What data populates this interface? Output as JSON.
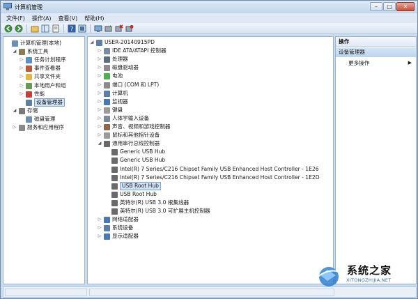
{
  "window": {
    "title": "计算机管理",
    "min_label": "–",
    "max_label": "□",
    "close_label": "✕"
  },
  "menu": [
    "文件(F)",
    "操作(A)",
    "查看(V)",
    "帮助(H)"
  ],
  "left_tree": [
    {
      "label": "计算机管理(本地)",
      "depth": 0,
      "expander": "",
      "icon": "computer-management-icon",
      "color": "#6a8fb8"
    },
    {
      "label": "系统工具",
      "depth": 1,
      "expander": "◢",
      "icon": "system-tools-icon",
      "color": "#8b7d5a"
    },
    {
      "label": "任务计划程序",
      "depth": 2,
      "expander": "▷",
      "icon": "task-scheduler-icon",
      "color": "#5b8fc7"
    },
    {
      "label": "事件查看器",
      "depth": 2,
      "expander": "▷",
      "icon": "event-viewer-icon",
      "color": "#b85a3c"
    },
    {
      "label": "共享文件夹",
      "depth": 2,
      "expander": "▷",
      "icon": "shared-folder-icon",
      "color": "#e0b64a"
    },
    {
      "label": "本地用户和组",
      "depth": 2,
      "expander": "▷",
      "icon": "users-icon",
      "color": "#6a9a5a"
    },
    {
      "label": "性能",
      "depth": 2,
      "expander": "▷",
      "icon": "performance-icon",
      "color": "#c83c3c"
    },
    {
      "label": "设备管理器",
      "depth": 2,
      "expander": "",
      "icon": "device-manager-icon",
      "color": "#5f7f9f",
      "selected": true
    },
    {
      "label": "存储",
      "depth": 1,
      "expander": "◢",
      "icon": "storage-icon",
      "color": "#7a7a7a"
    },
    {
      "label": "磁盘管理",
      "depth": 2,
      "expander": "",
      "icon": "disk-management-icon",
      "color": "#6e8fae"
    },
    {
      "label": "服务和应用程序",
      "depth": 1,
      "expander": "▷",
      "icon": "services-icon",
      "color": "#8a8a8a"
    }
  ],
  "device_tree": [
    {
      "label": "USER-20140915PD",
      "depth": 0,
      "expander": "◢",
      "icon": "computer-icon",
      "color": "#5a7fa8"
    },
    {
      "label": "IDE ATA/ATAPI 控制器",
      "depth": 1,
      "expander": "▷",
      "icon": "ide-controller-icon",
      "color": "#7b8ca0"
    },
    {
      "label": "处理器",
      "depth": 1,
      "expander": "▷",
      "icon": "processor-icon",
      "color": "#5b6e80"
    },
    {
      "label": "磁盘驱动器",
      "depth": 1,
      "expander": "▷",
      "icon": "disk-drive-icon",
      "color": "#8c8c8c"
    },
    {
      "label": "电池",
      "depth": 1,
      "expander": "▷",
      "icon": "battery-icon",
      "color": "#4caf50"
    },
    {
      "label": "端口 (COM 和 LPT)",
      "depth": 1,
      "expander": "▷",
      "icon": "port-icon",
      "color": "#8a8a8a"
    },
    {
      "label": "计算机",
      "depth": 1,
      "expander": "▷",
      "icon": "computer-icon",
      "color": "#5a7fa8"
    },
    {
      "label": "监视器",
      "depth": 1,
      "expander": "▷",
      "icon": "monitor-icon",
      "color": "#4b78b0"
    },
    {
      "label": "键盘",
      "depth": 1,
      "expander": "▷",
      "icon": "keyboard-icon",
      "color": "#9a9a9a"
    },
    {
      "label": "人体学输入设备",
      "depth": 1,
      "expander": "▷",
      "icon": "hid-icon",
      "color": "#7a8a9a"
    },
    {
      "label": "声音、视频和游戏控制器",
      "depth": 1,
      "expander": "▷",
      "icon": "sound-icon",
      "color": "#8a6a4a"
    },
    {
      "label": "鼠标和其他指针设备",
      "depth": 1,
      "expander": "▷",
      "icon": "mouse-icon",
      "color": "#9a9a9a"
    },
    {
      "label": "通用串行总线控制器",
      "depth": 1,
      "expander": "◢",
      "icon": "usb-icon",
      "color": "#6a6a6a"
    },
    {
      "label": "Generic USB Hub",
      "depth": 2,
      "expander": "",
      "icon": "usb-device-icon",
      "color": "#6a6a6a"
    },
    {
      "label": "Generic USB Hub",
      "depth": 2,
      "expander": "",
      "icon": "usb-device-icon",
      "color": "#6a6a6a"
    },
    {
      "label": "Intel(R) 7 Series/C216 Chipset Family USB Enhanced Host Controller - 1E26",
      "depth": 2,
      "expander": "",
      "icon": "usb-device-icon",
      "color": "#6a6a6a"
    },
    {
      "label": "Intel(R) 7 Series/C216 Chipset Family USB Enhanced Host Controller - 1E2D",
      "depth": 2,
      "expander": "",
      "icon": "usb-device-icon",
      "color": "#6a6a6a"
    },
    {
      "label": "USB Root Hub",
      "depth": 2,
      "expander": "",
      "icon": "usb-device-icon",
      "color": "#6a6a6a",
      "selected": true
    },
    {
      "label": "USB Root Hub",
      "depth": 2,
      "expander": "",
      "icon": "usb-device-icon",
      "color": "#6a6a6a"
    },
    {
      "label": "英特尔(R) USB 3.0 根集线器",
      "depth": 2,
      "expander": "",
      "icon": "usb-device-icon",
      "color": "#6a6a6a"
    },
    {
      "label": "英特尔(R) USB 3.0 可扩展主机控制器",
      "depth": 2,
      "expander": "",
      "icon": "usb-device-icon",
      "color": "#6a6a6a"
    },
    {
      "label": "网络适配器",
      "depth": 1,
      "expander": "▷",
      "icon": "network-adapter-icon",
      "color": "#4b78b0"
    },
    {
      "label": "系统设备",
      "depth": 1,
      "expander": "▷",
      "icon": "system-device-icon",
      "color": "#5a7fa8"
    },
    {
      "label": "显示适配器",
      "depth": 1,
      "expander": "▷",
      "icon": "display-adapter-icon",
      "color": "#4b78b0"
    }
  ],
  "actions": {
    "header": "操作",
    "section": "设备管理器",
    "more": "更多操作",
    "arrow": "▶"
  },
  "watermark": {
    "title": "系统之家",
    "url": "XITONGZHIJIA.NET"
  }
}
